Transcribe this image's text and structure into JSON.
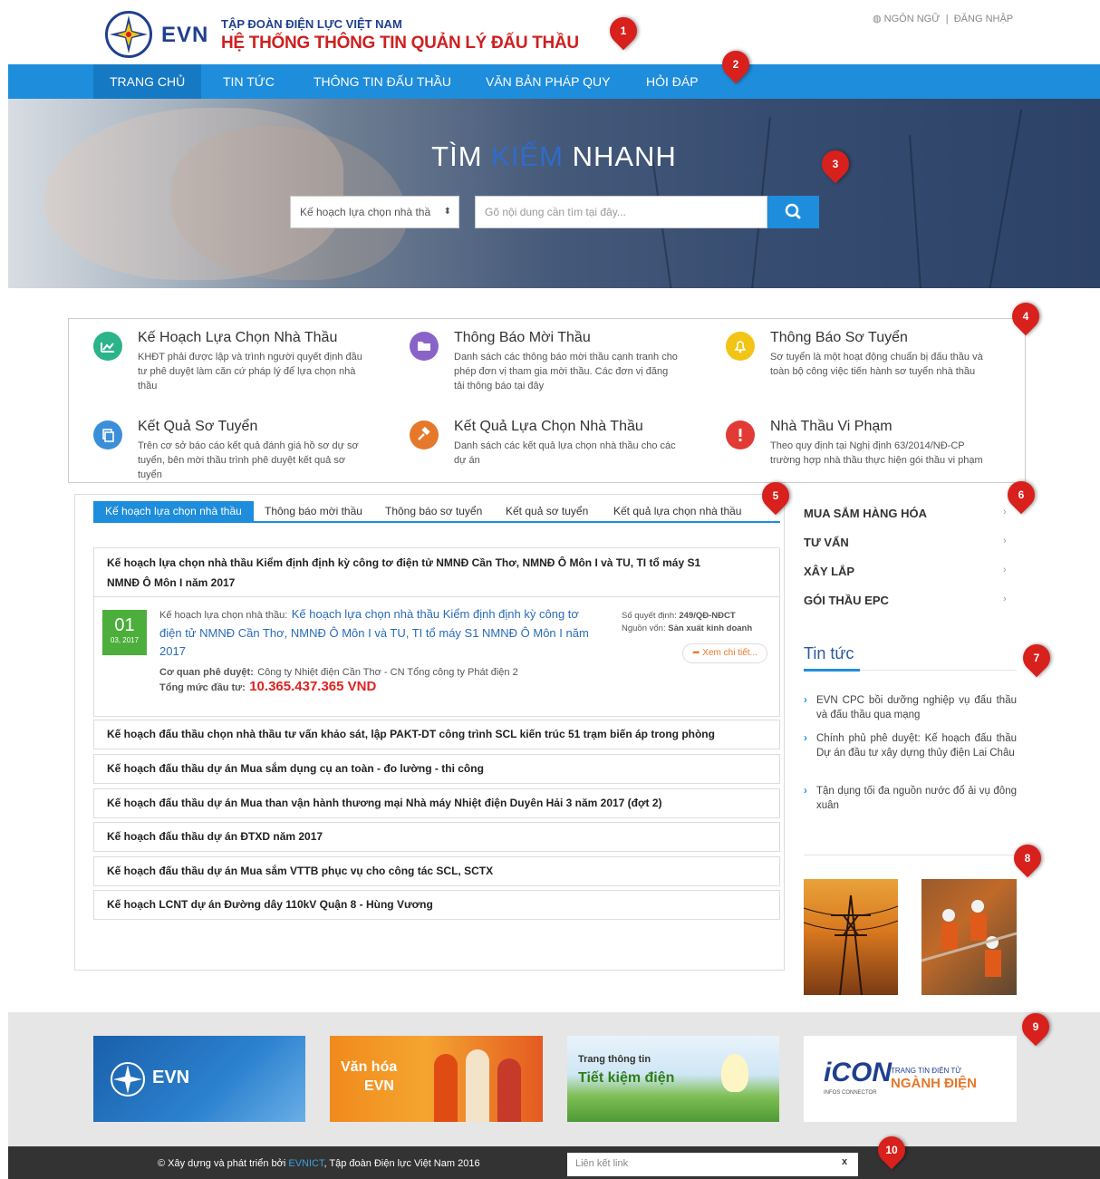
{
  "header": {
    "logo_text": "EVN",
    "org_name": "TẬP ĐOÀN ĐIỆN LỰC VIỆT NAM",
    "system_name": "HỆ THỐNG THÔNG TIN QUẢN LÝ ĐẤU THẦU",
    "language_label": "NGÔN NGỮ",
    "separator": "|",
    "login_label": "ĐĂNG NHẬP"
  },
  "nav": {
    "items": [
      {
        "label": "TRANG CHỦ",
        "active": true
      },
      {
        "label": "TIN TỨC"
      },
      {
        "label": "THÔNG TIN ĐẤU THẦU"
      },
      {
        "label": "VĂN BẢN PHÁP QUY"
      },
      {
        "label": "HỎI ĐÁP"
      }
    ]
  },
  "hero": {
    "title_left": "TÌM",
    "title_mid": "KIẾM",
    "title_right": "NHANH",
    "select_value": "Kế hoạch lựa chọn nhà thầ",
    "search_placeholder": "Gõ nội dung cần tìm tại đây..."
  },
  "services": [
    {
      "title": "Kế Hoạch Lựa Chọn Nhà Thầu",
      "desc": "KHĐT phải được lập và trình người quyết định đầu tư phê duyệt làm căn cứ pháp lý để lựa chọn nhà thầu",
      "icon": "chart-icon",
      "color": "#2bb38a"
    },
    {
      "title": "Thông Báo Mời Thầu",
      "desc": "Danh sách các thông báo mời thầu cạnh tranh cho phép đơn vị tham gia mời thầu. Các đơn vị đăng tải thông báo tại đây",
      "icon": "folder-icon",
      "color": "#8a63c8"
    },
    {
      "title": "Thông Báo Sơ Tuyển",
      "desc": "Sơ tuyển là một hoạt động chuẩn bị đấu thầu và toàn bộ công việc tiến hành sơ tuyển nhà thầu",
      "icon": "bell-icon",
      "color": "#f2c416"
    },
    {
      "title": "Kết Quả Sơ Tuyển",
      "desc": "Trên cơ sở báo cáo kết quả đánh giá hồ sơ dự sơ tuyển, bên mời thầu trình phê duyệt kết quả sơ tuyển",
      "icon": "copy-icon",
      "color": "#3b8fd9"
    },
    {
      "title": "Kết Quả Lựa Chọn Nhà Thầu",
      "desc": "Danh sách các kết quả lựa chọn nhà thầu cho các dự án",
      "icon": "gavel-icon",
      "color": "#e6782b"
    },
    {
      "title": "Nhà Thầu Vi Phạm",
      "desc": "Theo quy định tại Nghị định 63/2014/NĐ-CP trường hợp nhà thầu thực hiện gói thầu vi phạm",
      "icon": "warning-icon",
      "color": "#e23b35"
    }
  ],
  "tabs": [
    {
      "label": "Kế hoạch lựa chọn nhà thầu",
      "active": true
    },
    {
      "label": "Thông báo mời thầu"
    },
    {
      "label": "Thông báo sơ tuyển"
    },
    {
      "label": "Kết quả sơ tuyển"
    },
    {
      "label": "Kết quả lựa chọn nhà thầu"
    }
  ],
  "featured": {
    "title_line1": "Kế hoạch lựa chọn nhà thầu Kiểm định định kỳ công tơ điện tử NMNĐ Cần Thơ, NMNĐ Ô Môn I và TU, TI tổ máy S1",
    "title_line2": "NMNĐ Ô Môn I năm 2017",
    "date_day": "01",
    "date_month": "03, 2017",
    "plan_label": "Kế hoạch lựa chọn nhà thầu:",
    "plan_link": "Kế hoạch lựa chọn nhà thầu Kiểm định định kỳ công tơ điện tử NMNĐ Cần Thơ, NMNĐ Ô Môn I và TU, TI tổ máy S1 NMNĐ Ô Môn I năm 2017",
    "approver_label": "Cơ quan phê duyệt:",
    "approver": "Công ty Nhiệt điện Cần Thơ - CN Tổng công ty Phát điện 2",
    "total_label": "Tổng mức đầu tư:",
    "total": "10.365.437.365 VND",
    "decision_label": "Số quyết định:",
    "decision": "249/QĐ-NĐCT",
    "source_label": "Nguồn vốn:",
    "source": "Sản xuất kinh doanh",
    "more_label": "Xem chi tiết..."
  },
  "plans": [
    "Kế hoạch đấu thầu chọn nhà thầu tư vấn khảo sát, lập PAKT-DT công trình SCL kiến trúc 51 trạm biến áp trong phòng",
    "Kế hoạch đấu thầu dự án Mua sắm dụng cụ an toàn - đo lường - thi công",
    "Kế hoạch đấu thầu dự án Mua than vận hành thương mại Nhà máy Nhiệt điện Duyên Hải 3 năm 2017 (đợt 2)",
    "Kế hoạch đấu thầu dự án ĐTXD năm 2017",
    "Kế hoạch đấu thầu dự án Mua sắm VTTB phục vụ cho công tác SCL, SCTX",
    "Kế hoạch LCNT dự án Đường dây 110kV Quận 8 - Hùng Vương"
  ],
  "categories": [
    "MUA SẮM HÀNG HÓA",
    "TƯ VẤN",
    "XÂY LẮP",
    "GÓI THẦU EPC"
  ],
  "news": {
    "heading": "Tin tức",
    "items": [
      "EVN CPC bồi dưỡng nghiệp vụ đấu thầu và đấu thầu qua mạng",
      "Chính phủ phê duyệt: Kế hoạch đấu thầu Dự án đầu tư xây dựng thủy điện Lai Châu",
      "Tận dụng tối đa nguồn nước đổ ải vụ đông xuân"
    ]
  },
  "banners": {
    "evn": "EVN",
    "culture_line1": "Văn hóa",
    "culture_line2": "EVN",
    "saving_line1": "Trang thông tin",
    "saving_line2": "Tiết kiệm điện",
    "icon_logo": "iCON",
    "icon_sub": "INFOS CONNECTOR",
    "icon_line1": "TRANG TIN ĐIỆN TỬ",
    "icon_line2": "NGÀNH ĐIỆN"
  },
  "footer": {
    "prefix": "© Xây dựng và phát triển bởi ",
    "brand": "EVNICT",
    "suffix": ", Tập đoàn Điện lực Việt Nam 2016",
    "link_placeholder": "Liên kết link",
    "close": "x"
  },
  "markers": [
    "1",
    "2",
    "3",
    "4",
    "5",
    "6",
    "7",
    "8",
    "9",
    "10"
  ]
}
